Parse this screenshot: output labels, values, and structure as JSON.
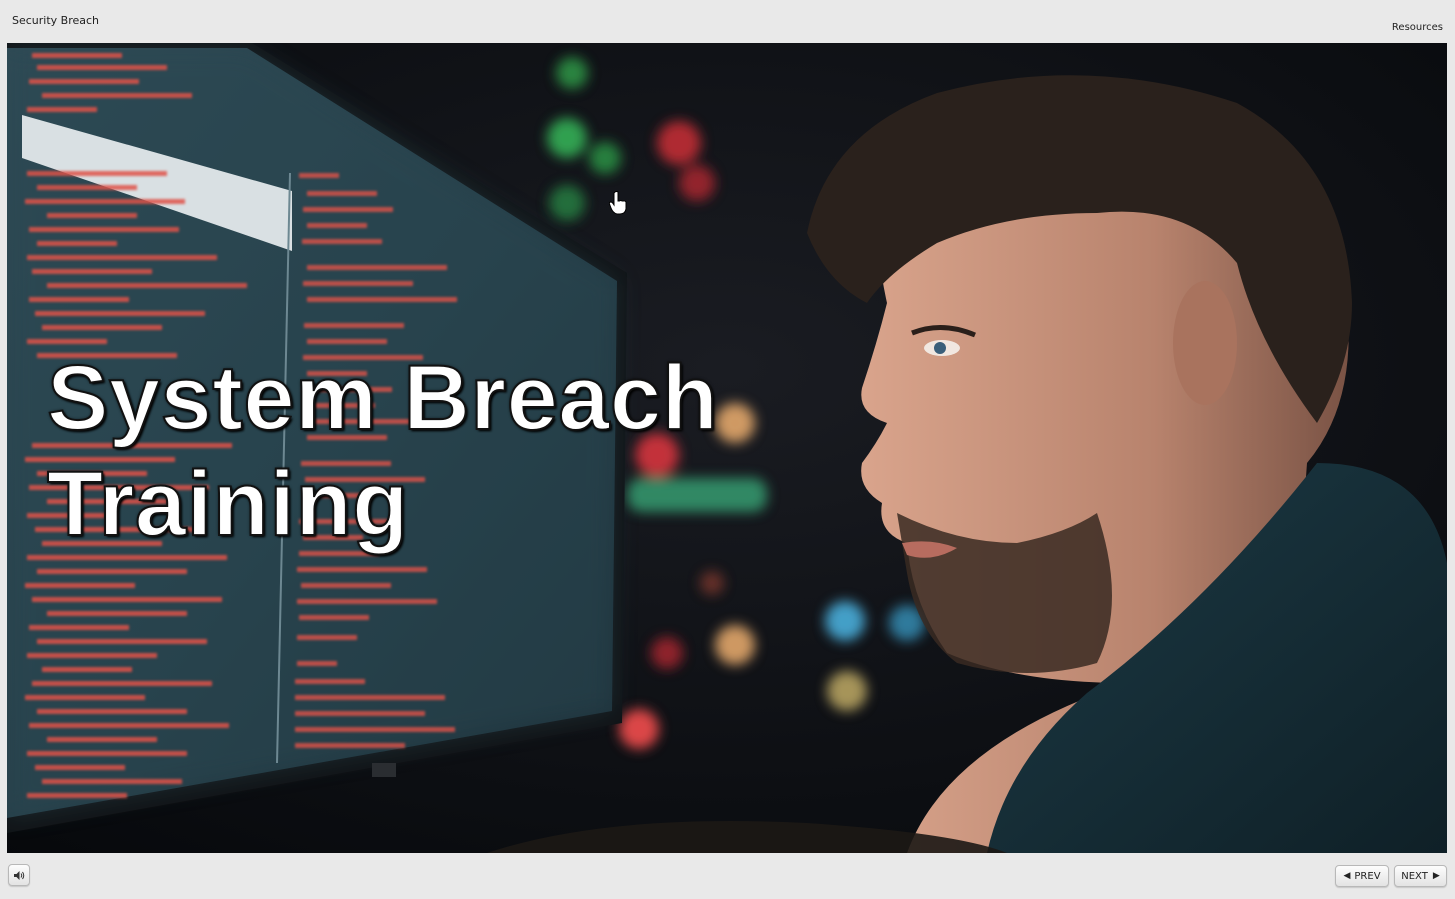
{
  "window": {
    "title": "Security Breach",
    "resources_label": "Resources"
  },
  "slide": {
    "title_line1": "System Breach",
    "title_line2": "Training"
  },
  "controls": {
    "volume_icon": "speaker-icon",
    "prev_label": "PREV",
    "next_label": "NEXT",
    "prev_icon": "chevron-left-icon",
    "next_icon": "chevron-right-icon"
  },
  "colors": {
    "chrome_bg": "#e9e9e9",
    "title_text": "#ffffff",
    "code_red": "#e0534a",
    "monitor_glow": "#4a6a75"
  }
}
